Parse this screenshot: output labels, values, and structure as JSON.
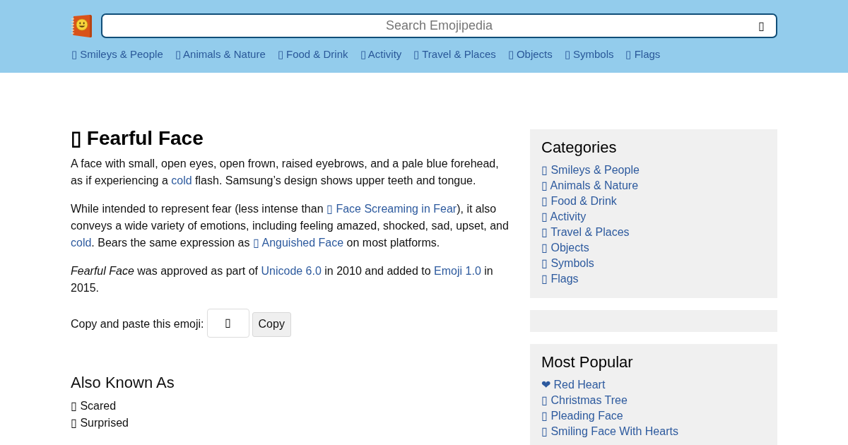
{
  "header": {
    "search": {
      "placeholder": "Search Emojipedia",
      "icon": "▯"
    },
    "nav": [
      {
        "glyph": "▯",
        "label": "Smileys & People"
      },
      {
        "glyph": "▯",
        "label": "Animals & Nature"
      },
      {
        "glyph": "▯",
        "label": "Food & Drink"
      },
      {
        "glyph": "▯",
        "label": "Activity"
      },
      {
        "glyph": "▯",
        "label": "Travel & Places"
      },
      {
        "glyph": "▯",
        "label": "Objects"
      },
      {
        "glyph": "▯",
        "label": "Symbols"
      },
      {
        "glyph": "▯",
        "label": "Flags"
      }
    ]
  },
  "article": {
    "title_glyph": "▯",
    "title": "Fearful Face",
    "paragraphs": [
      [
        {
          "kind": "text",
          "text": "A face with small, open eyes, open frown, raised eyebrows, and a pale blue forehead, as if experiencing a "
        },
        {
          "kind": "link",
          "text": "cold"
        },
        {
          "kind": "text",
          "text": " flash. Samsung’s design shows upper teeth and tongue."
        }
      ],
      [
        {
          "kind": "text",
          "text": "While intended to represent fear (less intense than "
        },
        {
          "kind": "link",
          "text": "▯ Face Screaming in Fear"
        },
        {
          "kind": "text",
          "text": "), it also conveys a wide variety of emotions, including feeling amazed, shocked, sad, upset, and "
        },
        {
          "kind": "link",
          "text": "cold"
        },
        {
          "kind": "text",
          "text": ". Bears the same expression as "
        },
        {
          "kind": "link",
          "text": "▯ Anguished Face"
        },
        {
          "kind": "text",
          "text": " on most platforms."
        }
      ],
      [
        {
          "kind": "text",
          "text": "*Fearful Face* was approved as part of "
        },
        {
          "kind": "link",
          "text": "Unicode 6.0"
        },
        {
          "kind": "text",
          "text": " in 2010 and added to "
        },
        {
          "kind": "link",
          "text": "Emoji 1.0"
        },
        {
          "kind": "text",
          "text": " in 2015."
        }
      ]
    ],
    "copy": {
      "label": "Copy and paste this emoji:",
      "value": "▯",
      "button": "Copy"
    },
    "also_known_as": {
      "heading": "Also Known As",
      "items": [
        {
          "glyph": "▯",
          "label": "Scared"
        },
        {
          "glyph": "▯",
          "label": "Surprised"
        }
      ]
    }
  },
  "sidebar": {
    "categories": {
      "heading": "Categories",
      "items": [
        {
          "glyph": "▯",
          "label": "Smileys & People"
        },
        {
          "glyph": "▯",
          "label": "Animals & Nature"
        },
        {
          "glyph": "▯",
          "label": "Food & Drink"
        },
        {
          "glyph": "▯",
          "label": "Activity"
        },
        {
          "glyph": "▯",
          "label": "Travel & Places"
        },
        {
          "glyph": "▯",
          "label": "Objects"
        },
        {
          "glyph": "▯",
          "label": "Symbols"
        },
        {
          "glyph": "▯",
          "label": "Flags"
        }
      ]
    },
    "most_popular": {
      "heading": "Most Popular",
      "items": [
        {
          "glyph": "❤",
          "label": "Red Heart"
        },
        {
          "glyph": "▯",
          "label": "Christmas Tree"
        },
        {
          "glyph": "▯",
          "label": "Pleading Face"
        },
        {
          "glyph": "▯",
          "label": "Smiling Face With Hearts"
        }
      ]
    }
  }
}
